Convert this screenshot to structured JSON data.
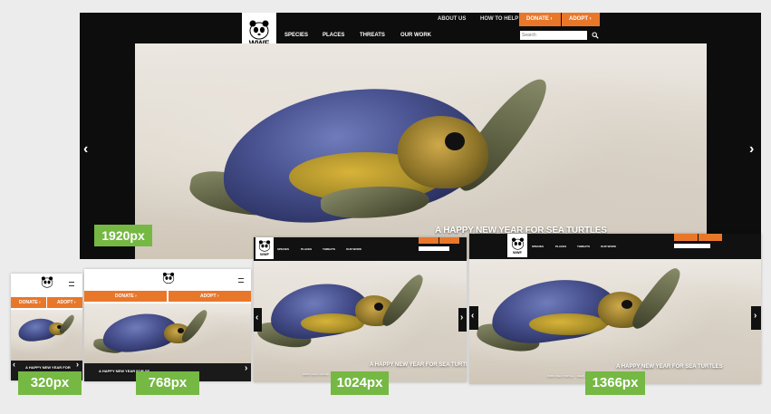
{
  "wwf": {
    "logo_text": "WWF",
    "nav": [
      "SPECIES",
      "PLACES",
      "THREATS",
      "OUR WORK"
    ],
    "top_links": [
      "ABOUT US",
      "HOW TO HELP"
    ],
    "donate": "DONATE ›",
    "adopt": "ADOPT ›",
    "search_placeholder": "Search",
    "headline": "A HAPPY NEW YEAR FOR SEA TURTLES",
    "headline_320": "A HAPPY NEW YEAR FOR",
    "headline_768": "A HAPPY NEW YEAR FOR SE",
    "caption_small": "WWF's SEA TURTLE ... SEEN AROUND THE GLOBE IN EARLY 2016"
  },
  "breakpoints": {
    "b1920": "1920px",
    "b320": "320px",
    "b768": "768px",
    "b1024": "1024px",
    "b1366": "1366px"
  },
  "colors": {
    "green_label": "#75b843",
    "orange": "#e8772a",
    "nav_black": "#111111"
  }
}
